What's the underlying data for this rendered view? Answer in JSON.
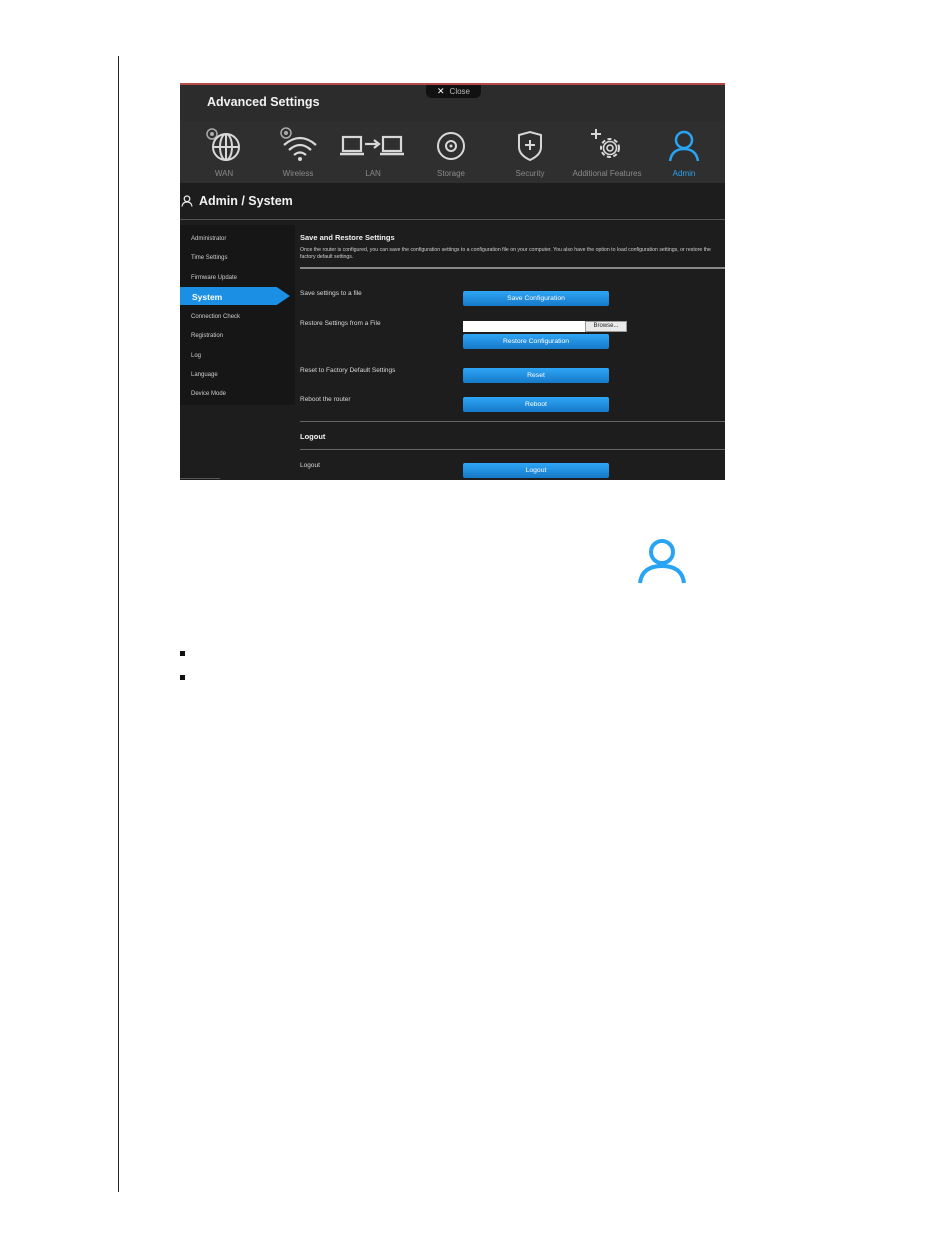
{
  "window": {
    "title": "Advanced Settings",
    "close_label": "Close"
  },
  "nav": {
    "items": [
      {
        "label": "WAN",
        "icon": "globe-icon"
      },
      {
        "label": "Wireless",
        "icon": "wifi-icon"
      },
      {
        "label": "LAN",
        "icon": "lan-icon"
      },
      {
        "label": "Storage",
        "icon": "storage-icon"
      },
      {
        "label": "Security",
        "icon": "shield-icon"
      },
      {
        "label": "Additional Features",
        "icon": "gear-icon"
      },
      {
        "label": "Admin",
        "icon": "user-icon"
      }
    ],
    "active_label": "Admin"
  },
  "breadcrumb": {
    "title": "Admin / System"
  },
  "sidebar": {
    "items": [
      {
        "label": "Administrator"
      },
      {
        "label": "Time Settings"
      },
      {
        "label": "Firmware Update"
      },
      {
        "label": "System"
      },
      {
        "label": "Connection Check"
      },
      {
        "label": "Registration"
      },
      {
        "label": "Log"
      },
      {
        "label": "Language"
      },
      {
        "label": "Device Mode"
      }
    ],
    "active_label": "System"
  },
  "main": {
    "save_restore": {
      "title": "Save and Restore Settings",
      "description": "Once the router is configured, you can save the configuration settings to a configuration file on your computer. You also have the option to load configuration settings, or restore the factory default settings.",
      "save_label": "Save settings to a file",
      "save_button": "Save Configuration",
      "restore_label": "Restore Settings from a File",
      "file_value": "",
      "browse_button": "Browse...",
      "restore_button": "Restore Configuration",
      "reset_label": "Reset to Factory Default Settings",
      "reset_button": "Reset",
      "reboot_label": "Reboot the router",
      "reboot_button": "Reboot"
    },
    "logout": {
      "title": "Logout",
      "label": "Logout",
      "button": "Logout"
    }
  },
  "colors": {
    "accent": "#1a8fe3",
    "active_nav": "#29a4f2",
    "background": "#1d1d1d"
  }
}
